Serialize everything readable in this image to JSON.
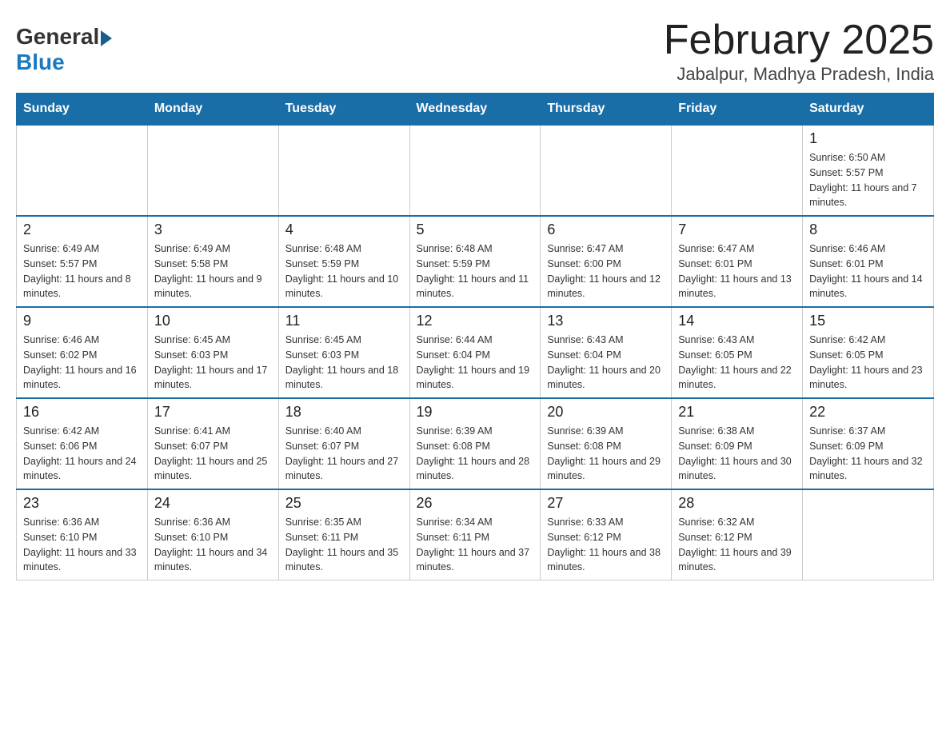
{
  "header": {
    "logo_general": "General",
    "logo_blue": "Blue",
    "calendar_title": "February 2025",
    "calendar_subtitle": "Jabalpur, Madhya Pradesh, India"
  },
  "days_of_week": [
    "Sunday",
    "Monday",
    "Tuesday",
    "Wednesday",
    "Thursday",
    "Friday",
    "Saturday"
  ],
  "weeks": [
    [
      {
        "day": "",
        "info": ""
      },
      {
        "day": "",
        "info": ""
      },
      {
        "day": "",
        "info": ""
      },
      {
        "day": "",
        "info": ""
      },
      {
        "day": "",
        "info": ""
      },
      {
        "day": "",
        "info": ""
      },
      {
        "day": "1",
        "info": "Sunrise: 6:50 AM\nSunset: 5:57 PM\nDaylight: 11 hours and 7 minutes."
      }
    ],
    [
      {
        "day": "2",
        "info": "Sunrise: 6:49 AM\nSunset: 5:57 PM\nDaylight: 11 hours and 8 minutes."
      },
      {
        "day": "3",
        "info": "Sunrise: 6:49 AM\nSunset: 5:58 PM\nDaylight: 11 hours and 9 minutes."
      },
      {
        "day": "4",
        "info": "Sunrise: 6:48 AM\nSunset: 5:59 PM\nDaylight: 11 hours and 10 minutes."
      },
      {
        "day": "5",
        "info": "Sunrise: 6:48 AM\nSunset: 5:59 PM\nDaylight: 11 hours and 11 minutes."
      },
      {
        "day": "6",
        "info": "Sunrise: 6:47 AM\nSunset: 6:00 PM\nDaylight: 11 hours and 12 minutes."
      },
      {
        "day": "7",
        "info": "Sunrise: 6:47 AM\nSunset: 6:01 PM\nDaylight: 11 hours and 13 minutes."
      },
      {
        "day": "8",
        "info": "Sunrise: 6:46 AM\nSunset: 6:01 PM\nDaylight: 11 hours and 14 minutes."
      }
    ],
    [
      {
        "day": "9",
        "info": "Sunrise: 6:46 AM\nSunset: 6:02 PM\nDaylight: 11 hours and 16 minutes."
      },
      {
        "day": "10",
        "info": "Sunrise: 6:45 AM\nSunset: 6:03 PM\nDaylight: 11 hours and 17 minutes."
      },
      {
        "day": "11",
        "info": "Sunrise: 6:45 AM\nSunset: 6:03 PM\nDaylight: 11 hours and 18 minutes."
      },
      {
        "day": "12",
        "info": "Sunrise: 6:44 AM\nSunset: 6:04 PM\nDaylight: 11 hours and 19 minutes."
      },
      {
        "day": "13",
        "info": "Sunrise: 6:43 AM\nSunset: 6:04 PM\nDaylight: 11 hours and 20 minutes."
      },
      {
        "day": "14",
        "info": "Sunrise: 6:43 AM\nSunset: 6:05 PM\nDaylight: 11 hours and 22 minutes."
      },
      {
        "day": "15",
        "info": "Sunrise: 6:42 AM\nSunset: 6:05 PM\nDaylight: 11 hours and 23 minutes."
      }
    ],
    [
      {
        "day": "16",
        "info": "Sunrise: 6:42 AM\nSunset: 6:06 PM\nDaylight: 11 hours and 24 minutes."
      },
      {
        "day": "17",
        "info": "Sunrise: 6:41 AM\nSunset: 6:07 PM\nDaylight: 11 hours and 25 minutes."
      },
      {
        "day": "18",
        "info": "Sunrise: 6:40 AM\nSunset: 6:07 PM\nDaylight: 11 hours and 27 minutes."
      },
      {
        "day": "19",
        "info": "Sunrise: 6:39 AM\nSunset: 6:08 PM\nDaylight: 11 hours and 28 minutes."
      },
      {
        "day": "20",
        "info": "Sunrise: 6:39 AM\nSunset: 6:08 PM\nDaylight: 11 hours and 29 minutes."
      },
      {
        "day": "21",
        "info": "Sunrise: 6:38 AM\nSunset: 6:09 PM\nDaylight: 11 hours and 30 minutes."
      },
      {
        "day": "22",
        "info": "Sunrise: 6:37 AM\nSunset: 6:09 PM\nDaylight: 11 hours and 32 minutes."
      }
    ],
    [
      {
        "day": "23",
        "info": "Sunrise: 6:36 AM\nSunset: 6:10 PM\nDaylight: 11 hours and 33 minutes."
      },
      {
        "day": "24",
        "info": "Sunrise: 6:36 AM\nSunset: 6:10 PM\nDaylight: 11 hours and 34 minutes."
      },
      {
        "day": "25",
        "info": "Sunrise: 6:35 AM\nSunset: 6:11 PM\nDaylight: 11 hours and 35 minutes."
      },
      {
        "day": "26",
        "info": "Sunrise: 6:34 AM\nSunset: 6:11 PM\nDaylight: 11 hours and 37 minutes."
      },
      {
        "day": "27",
        "info": "Sunrise: 6:33 AM\nSunset: 6:12 PM\nDaylight: 11 hours and 38 minutes."
      },
      {
        "day": "28",
        "info": "Sunrise: 6:32 AM\nSunset: 6:12 PM\nDaylight: 11 hours and 39 minutes."
      },
      {
        "day": "",
        "info": ""
      }
    ]
  ]
}
